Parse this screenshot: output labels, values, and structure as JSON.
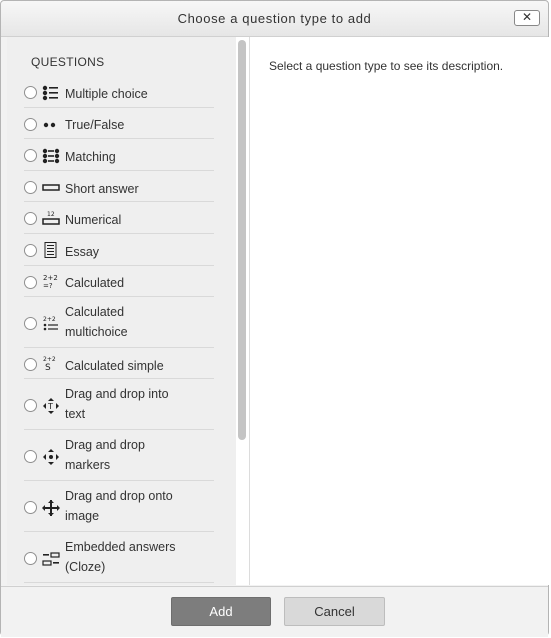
{
  "dialog": {
    "title": "Choose a question type to add",
    "close_label": "✕",
    "section_label": "QUESTIONS",
    "description_prompt": "Select a question type to see its description.",
    "add_label": "Add",
    "cancel_label": "Cancel"
  },
  "questions": [
    {
      "label": "Multiple choice",
      "icon": "multiple-choice-icon"
    },
    {
      "label": "True/False",
      "icon": "true-false-icon"
    },
    {
      "label": "Matching",
      "icon": "matching-icon"
    },
    {
      "label": "Short answer",
      "icon": "short-answer-icon"
    },
    {
      "label": "Numerical",
      "icon": "numerical-icon"
    },
    {
      "label": "Essay",
      "icon": "essay-icon"
    },
    {
      "label": "Calculated",
      "icon": "calculated-icon"
    },
    {
      "label": "Calculated multichoice",
      "icon": "calculated-multichoice-icon"
    },
    {
      "label": "Calculated simple",
      "icon": "calculated-simple-icon"
    },
    {
      "label": "Drag and drop into text",
      "icon": "drag-drop-text-icon"
    },
    {
      "label": "Drag and drop markers",
      "icon": "drag-drop-markers-icon"
    },
    {
      "label": "Drag and drop onto image",
      "icon": "drag-drop-image-icon"
    },
    {
      "label": "Embedded answers (Cloze)",
      "icon": "embedded-answers-icon"
    }
  ],
  "colors": {
    "primary_button": "#7d7d7d",
    "secondary_button": "#d9d9d9",
    "pane_background": "#efefef"
  }
}
